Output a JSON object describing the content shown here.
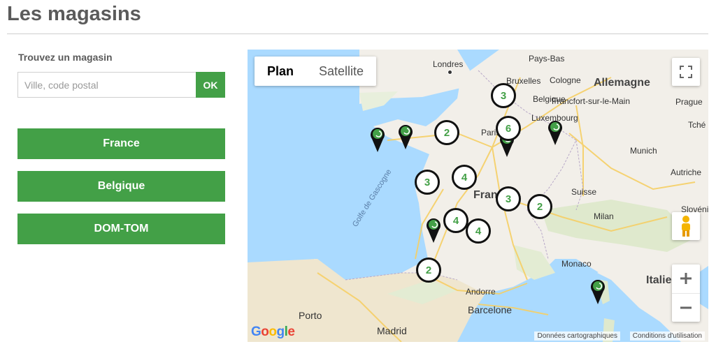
{
  "page": {
    "title": "Les magasins"
  },
  "finder": {
    "label": "Trouvez un magasin",
    "placeholder": "Ville, code postal",
    "ok_label": "OK"
  },
  "countries": [
    "France",
    "Belgique",
    "DOM-TOM"
  ],
  "colors": {
    "accent": "#43a047",
    "sea": "#aadaff",
    "land": "#f2efe9"
  },
  "map": {
    "type_control": {
      "plan": "Plan",
      "satellite": "Satellite",
      "selected": "Plan"
    },
    "places": {
      "londres": "Londres",
      "pays_bas": "Pays-Bas",
      "bruxelles": "Bruxelles",
      "cologne": "Cologne",
      "belgique": "Belgique",
      "allemagne": "Allemagne",
      "francfort": "Francfort-sur-le-Main",
      "prague": "Prague",
      "luxembourg": "Luxembourg",
      "tche": "Tché",
      "paris": "Paris",
      "munich": "Munich",
      "autriche": "Autriche",
      "france": "France",
      "suisse": "Suisse",
      "slovenie": "Slovéni",
      "milan": "Milan",
      "monaco": "Monaco",
      "italie": "Italie",
      "andorre": "Andorre",
      "barcelone": "Barcelone",
      "porto": "Porto",
      "madrid": "Madrid",
      "golfe": "Golfe de Gascogne"
    },
    "clusters": [
      {
        "id": "brussels",
        "count": "3"
      },
      {
        "id": "paris",
        "count": "6"
      },
      {
        "id": "normandy",
        "count": "2"
      },
      {
        "id": "nantes",
        "count": "3"
      },
      {
        "id": "tours",
        "count": "4"
      },
      {
        "id": "center",
        "count": "3"
      },
      {
        "id": "lyon",
        "count": "2"
      },
      {
        "id": "limoges",
        "count": "4"
      },
      {
        "id": "clermont",
        "count": "4"
      },
      {
        "id": "toulouse",
        "count": "2"
      }
    ],
    "attribution": {
      "data": "Données cartographiques",
      "terms": "Conditions d'utilisation"
    },
    "logo": "Google"
  }
}
